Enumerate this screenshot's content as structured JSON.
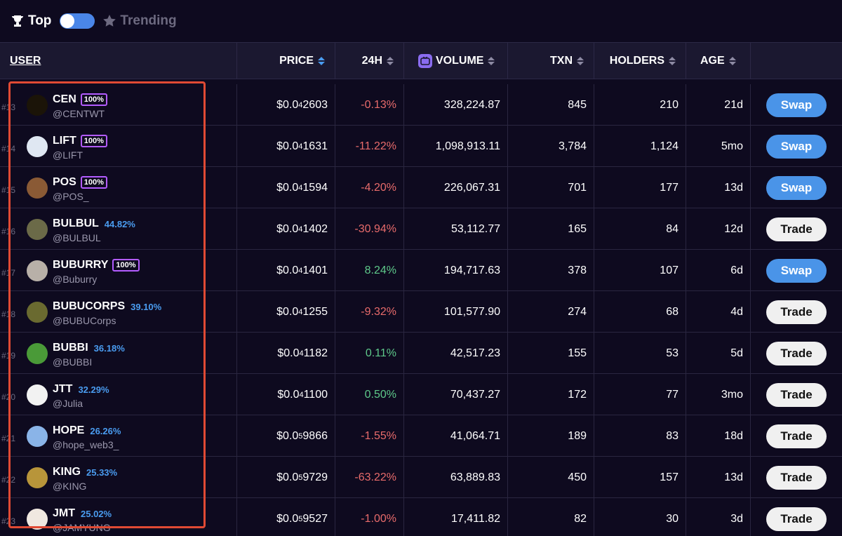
{
  "topbar": {
    "top_label": "Top",
    "trending_label": "Trending",
    "top_icon": "trophy-icon",
    "trending_icon": "star-icon"
  },
  "columns": {
    "user": "USER",
    "price": "PRICE",
    "change": "24H",
    "volume": "VOLUME",
    "txn": "TXN",
    "holders": "HOLDERS",
    "age": "AGE"
  },
  "colors": {
    "accent_blue": "#4a94e8",
    "negative": "#e86b6b",
    "positive": "#5ec98a",
    "highlight_box": "#e04a34"
  },
  "rows": [
    {
      "rank": "#13",
      "name": "CEN",
      "badge": "100%",
      "pct": "",
      "handle": "@CENTWT",
      "price_pre": "$0.0",
      "price_sub": "4",
      "price_post": "2603",
      "change": "-0.13%",
      "dir": "neg",
      "volume": "328,224.87",
      "txn": "845",
      "holders": "210",
      "age": "21d",
      "action": "Swap",
      "avatar": "#1b1408"
    },
    {
      "rank": "#14",
      "name": "LIFT",
      "badge": "100%",
      "pct": "",
      "handle": "@LIFT",
      "price_pre": "$0.0",
      "price_sub": "4",
      "price_post": "1631",
      "change": "-11.22%",
      "dir": "neg",
      "volume": "1,098,913.11",
      "txn": "3,784",
      "holders": "1,124",
      "age": "5mo",
      "action": "Swap",
      "avatar": "#dfe7f2"
    },
    {
      "rank": "#15",
      "name": "POS",
      "badge": "100%",
      "pct": "",
      "handle": "@POS_",
      "price_pre": "$0.0",
      "price_sub": "4",
      "price_post": "1594",
      "change": "-4.20%",
      "dir": "neg",
      "volume": "226,067.31",
      "txn": "701",
      "holders": "177",
      "age": "13d",
      "action": "Swap",
      "avatar": "#8a5a35"
    },
    {
      "rank": "#16",
      "name": "BULBUL",
      "badge": "",
      "pct": "44.82%",
      "handle": "@BULBUL",
      "price_pre": "$0.0",
      "price_sub": "4",
      "price_post": "1402",
      "change": "-30.94%",
      "dir": "neg",
      "volume": "53,112.77",
      "txn": "165",
      "holders": "84",
      "age": "12d",
      "action": "Trade",
      "avatar": "#6b6a48"
    },
    {
      "rank": "#17",
      "name": "BUBURRY",
      "badge": "100%",
      "pct": "",
      "handle": "@Buburry",
      "price_pre": "$0.0",
      "price_sub": "4",
      "price_post": "1401",
      "change": "8.24%",
      "dir": "pos",
      "volume": "194,717.63",
      "txn": "378",
      "holders": "107",
      "age": "6d",
      "action": "Swap",
      "avatar": "#b8b0a8"
    },
    {
      "rank": "#18",
      "name": "BUBUCORPS",
      "badge": "",
      "pct": "39.10%",
      "handle": "@BUBUCorps",
      "price_pre": "$0.0",
      "price_sub": "4",
      "price_post": "1255",
      "change": "-9.32%",
      "dir": "neg",
      "volume": "101,577.90",
      "txn": "274",
      "holders": "68",
      "age": "4d",
      "action": "Trade",
      "avatar": "#6a6a30"
    },
    {
      "rank": "#19",
      "name": "BUBBI",
      "badge": "",
      "pct": "36.18%",
      "handle": "@BUBBI",
      "price_pre": "$0.0",
      "price_sub": "4",
      "price_post": "1182",
      "change": "0.11%",
      "dir": "pos",
      "volume": "42,517.23",
      "txn": "155",
      "holders": "53",
      "age": "5d",
      "action": "Trade",
      "avatar": "#4a9a38"
    },
    {
      "rank": "#20",
      "name": "JTT",
      "badge": "",
      "pct": "32.29%",
      "handle": "@Julia",
      "price_pre": "$0.0",
      "price_sub": "4",
      "price_post": "1100",
      "change": "0.50%",
      "dir": "pos",
      "volume": "70,437.27",
      "txn": "172",
      "holders": "77",
      "age": "3mo",
      "action": "Trade",
      "avatar": "#f2f2f2"
    },
    {
      "rank": "#21",
      "name": "HOPE",
      "badge": "",
      "pct": "26.26%",
      "handle": "@hope_web3_",
      "price_pre": "$0.0",
      "price_sub": "5",
      "price_post": "9866",
      "change": "-1.55%",
      "dir": "neg",
      "volume": "41,064.71",
      "txn": "189",
      "holders": "83",
      "age": "18d",
      "action": "Trade",
      "avatar": "#8ab4e8"
    },
    {
      "rank": "#22",
      "name": "KING",
      "badge": "",
      "pct": "25.33%",
      "handle": "@KING",
      "price_pre": "$0.0",
      "price_sub": "5",
      "price_post": "9729",
      "change": "-63.22%",
      "dir": "neg",
      "volume": "63,889.83",
      "txn": "450",
      "holders": "157",
      "age": "13d",
      "action": "Trade",
      "avatar": "#b8953a"
    },
    {
      "rank": "#23",
      "name": "JMT",
      "badge": "",
      "pct": "25.02%",
      "handle": "@JAMYUNG",
      "price_pre": "$0.0",
      "price_sub": "5",
      "price_post": "9527",
      "change": "-1.00%",
      "dir": "neg",
      "volume": "17,411.82",
      "txn": "82",
      "holders": "30",
      "age": "3d",
      "action": "Trade",
      "avatar": "#f0e8e0"
    }
  ]
}
